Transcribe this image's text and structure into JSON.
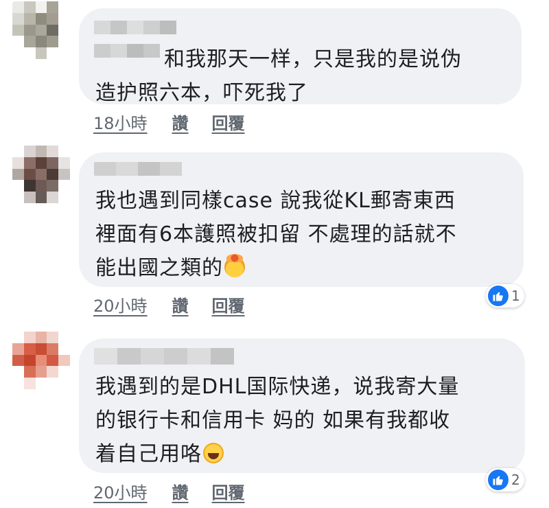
{
  "comments": [
    {
      "text": "和我那天一样，只是我的是说伪\n造护照六本，吓死我了",
      "emoji": "",
      "time": "18小時",
      "like_label": "讚",
      "reply_label": "回覆",
      "reaction_count": ""
    },
    {
      "text": "我也遇到同樣case 說我從KL郵寄東西\n裡面有6本護照被扣留 不處理的話就不\n能出國之類的",
      "emoji": "exploding-head-emoji",
      "time": "20小時",
      "like_label": "讚",
      "reply_label": "回覆",
      "reaction_count": "1"
    },
    {
      "text": "我遇到的是DHL国际快递，说我寄大量\n的银行卡和信用卡 妈的 如果有我都收\n着自己用咯",
      "emoji": "tears-of-joy-emoji",
      "time": "20小時",
      "like_label": "讚",
      "reply_label": "回覆",
      "reaction_count": "2"
    }
  ],
  "colors": {
    "bubble": "#eff1f4",
    "meta_text": "#606770",
    "like_blue": "#1877f2"
  }
}
